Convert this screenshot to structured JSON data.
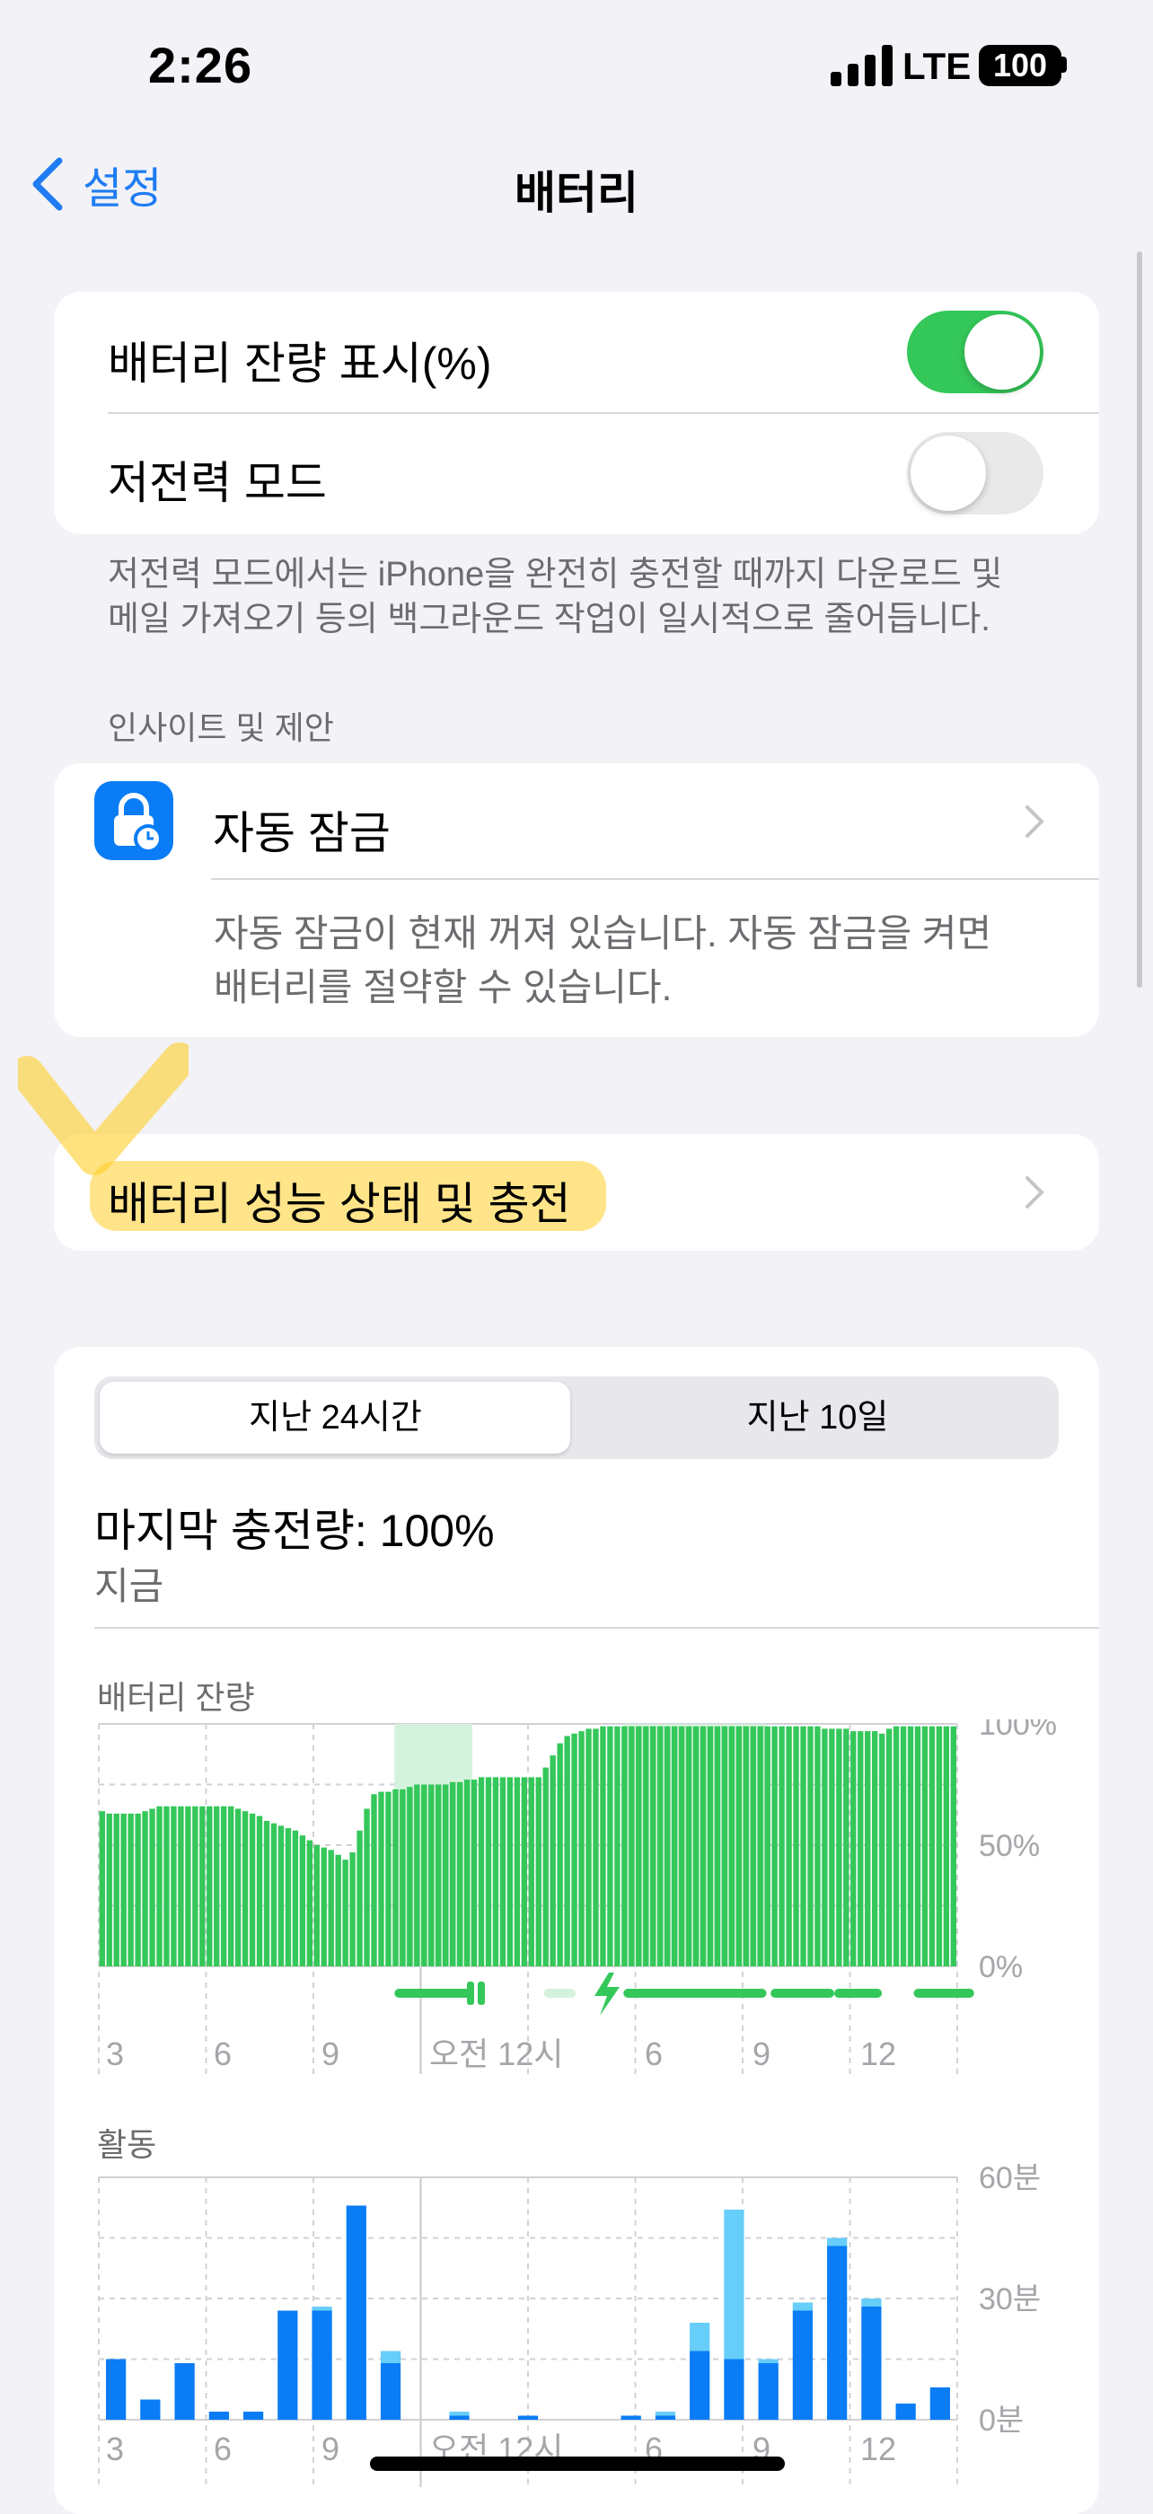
{
  "status_bar": {
    "time": "2:26",
    "network": "LTE",
    "battery": "100"
  },
  "nav": {
    "back_label": "설정",
    "title": "배터리"
  },
  "settings": {
    "battery_percentage": {
      "label": "배터리 잔량 표시(%)",
      "on": true
    },
    "low_power_mode": {
      "label": "저전력 모드",
      "on": false
    },
    "low_power_footer_line1": "저전력 모드에서는 iPhone을 완전히 충전할 때까지 다운로드 및",
    "low_power_footer_line2": "메일 가져오기 등의 백그라운드 작업이 일시적으로 줄어듭니다."
  },
  "insights": {
    "header": "인사이트 및 제안",
    "auto_lock_title": "자동 잠금",
    "auto_lock_desc_line1": "자동 잠금이 현재 꺼져 있습니다. 자동 잠금을 켜면",
    "auto_lock_desc_line2": "배터리를 절약할 수 있습니다."
  },
  "battery_health": {
    "label": "배터리 성능 상태 및 충전"
  },
  "usage": {
    "tabs": [
      "지난 24시간",
      "지난 10일"
    ],
    "selected_tab": 0,
    "last_charge_label": "마지막 충전량: 100%",
    "last_charge_time": "지금"
  },
  "colors": {
    "accent": "#1f7cf2",
    "green": "#34c759",
    "bar_blue": "#0a7cf5",
    "bar_light_blue": "#67cdf9"
  },
  "chart_data": [
    {
      "type": "bar",
      "title": "배터리 잔량",
      "y_ticks": [
        "100%",
        "50%",
        "0%"
      ],
      "x_ticks": [
        "3",
        "6",
        "9",
        "오전 12시",
        "6",
        "9",
        "12"
      ],
      "ylim": [
        0,
        100
      ],
      "values": [
        64,
        63,
        63,
        63,
        63,
        63,
        64,
        65,
        66,
        66,
        66,
        66,
        66,
        66,
        66,
        66,
        66,
        66,
        66,
        65,
        64,
        63,
        62,
        60,
        59,
        58,
        57,
        56,
        54,
        52,
        50,
        49,
        48,
        46,
        44,
        47,
        56,
        65,
        71,
        72,
        72,
        73,
        73,
        74,
        75,
        75,
        75,
        75,
        75,
        76,
        76,
        77,
        77,
        78,
        78,
        78,
        78,
        78,
        78,
        78,
        78,
        78,
        82,
        87,
        92,
        95,
        96,
        97,
        98,
        98,
        99,
        99,
        99,
        99,
        99,
        99,
        99,
        99,
        99,
        99,
        99,
        99,
        99,
        99,
        99,
        99,
        99,
        99,
        99,
        99,
        99,
        99,
        99,
        99,
        99,
        99,
        99,
        99,
        99,
        99,
        99,
        98,
        98,
        98,
        98,
        97,
        97,
        97,
        97,
        96,
        98,
        99,
        99,
        99,
        99,
        99,
        99,
        99,
        99,
        99
      ],
      "charging_indicator": true
    },
    {
      "type": "bar",
      "title": "활동",
      "y_ticks": [
        "60분",
        "30분",
        "0분"
      ],
      "x_ticks": [
        "3",
        "6",
        "9",
        "오전 12시",
        "6",
        "9",
        "12"
      ],
      "ylim": [
        0,
        60
      ],
      "series": [
        {
          "name": "screen_on",
          "values": [
            15,
            5,
            14,
            2,
            2,
            27,
            27,
            53,
            14,
            0,
            1,
            0,
            1,
            0,
            0,
            1,
            1,
            17,
            15,
            14,
            27,
            43,
            28,
            4,
            8
          ]
        },
        {
          "name": "screen_off",
          "values": [
            0,
            0,
            0,
            0,
            0,
            0,
            1,
            0,
            3,
            0,
            1,
            0,
            0,
            0,
            0,
            0,
            1,
            7,
            37,
            1,
            2,
            2,
            2,
            0,
            0
          ]
        }
      ]
    }
  ]
}
